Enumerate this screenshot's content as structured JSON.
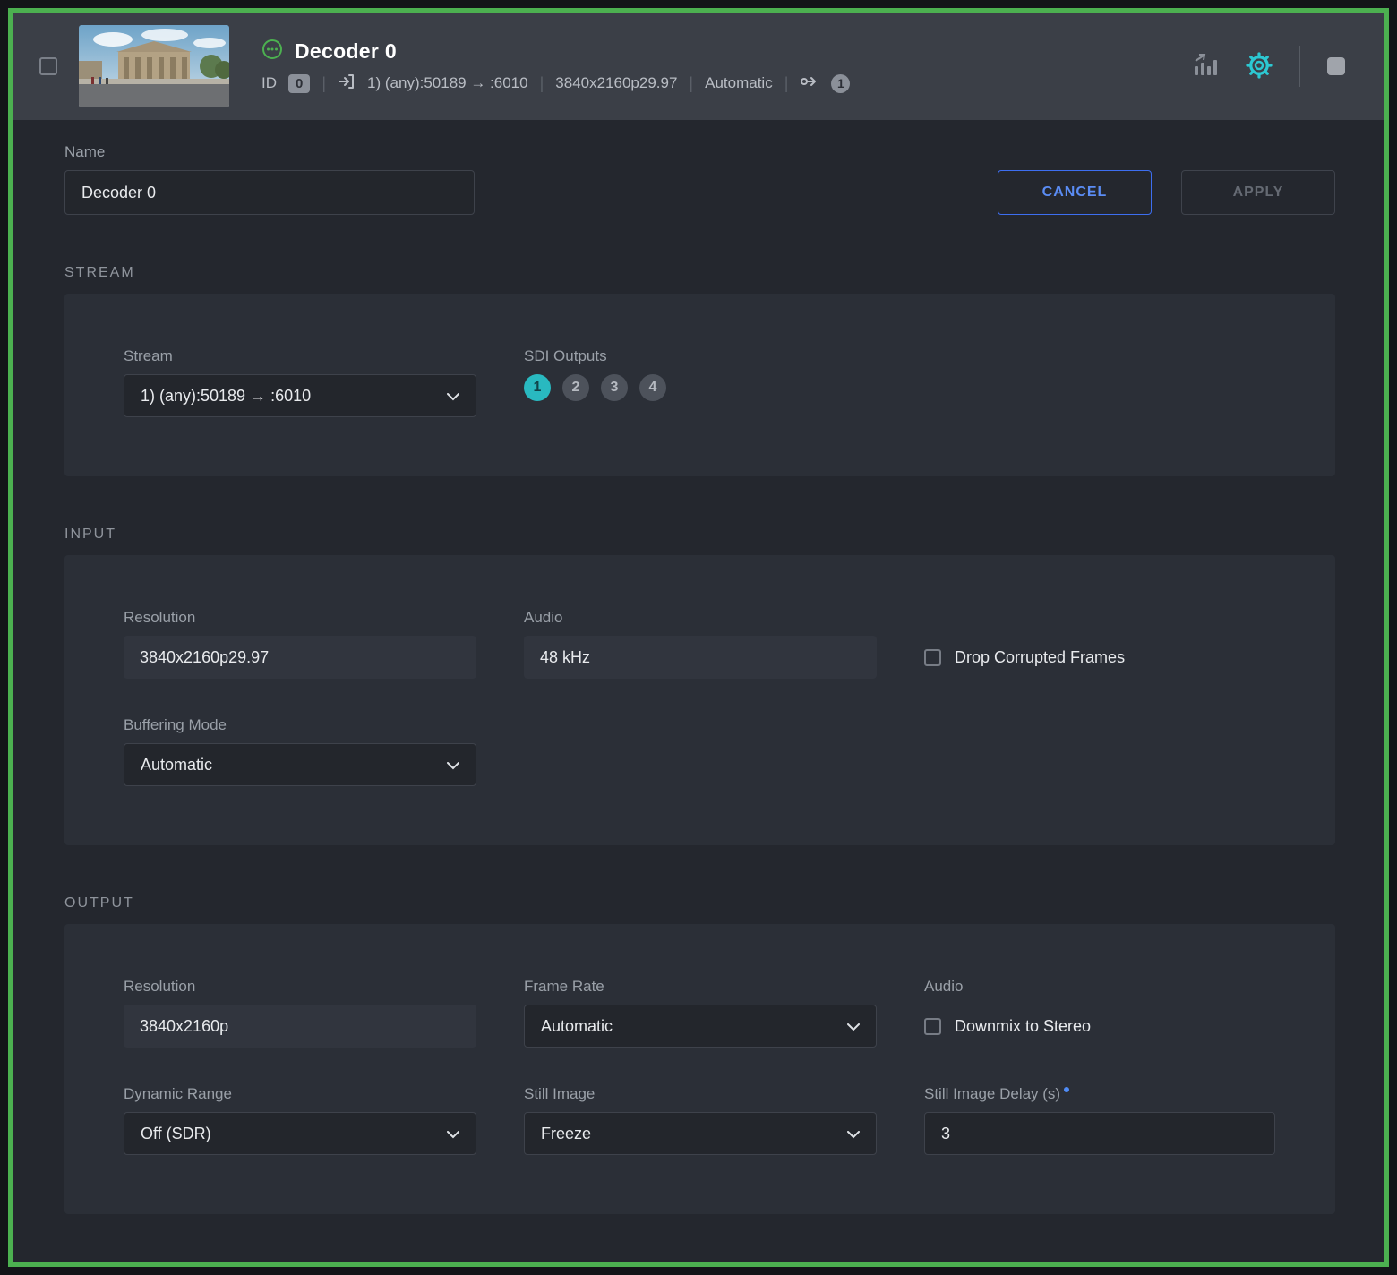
{
  "header": {
    "title": "Decoder 0",
    "id_label": "ID",
    "id_value": "0",
    "separator": "|",
    "stream_info": "1) (any):50189 → :6010",
    "resolution": "3840x2160p29.97",
    "buffering": "Automatic",
    "output_count": "1"
  },
  "name_form": {
    "label": "Name",
    "value": "Decoder 0",
    "cancel": "CANCEL",
    "apply": "APPLY"
  },
  "stream": {
    "section_title": "STREAM",
    "stream_label": "Stream",
    "stream_value": "1) (any):50189 → :6010",
    "sdi_label": "SDI Outputs",
    "sdi": [
      "1",
      "2",
      "3",
      "4"
    ]
  },
  "input": {
    "section_title": "INPUT",
    "resolution_label": "Resolution",
    "resolution": "3840x2160p29.97",
    "audio_label": "Audio",
    "audio": "48 kHz",
    "drop_corrupted": "Drop Corrupted Frames",
    "buffering_label": "Buffering Mode",
    "buffering": "Automatic"
  },
  "output": {
    "section_title": "OUTPUT",
    "resolution_label": "Resolution",
    "resolution": "3840x2160p",
    "frame_rate_label": "Frame Rate",
    "frame_rate": "Automatic",
    "audio_label": "Audio",
    "downmix": "Downmix to Stereo",
    "dynamic_range_label": "Dynamic Range",
    "dynamic_range": "Off (SDR)",
    "still_image_label": "Still Image",
    "still_image": "Freeze",
    "still_delay_label": "Still Image Delay (s)",
    "still_delay": "3"
  },
  "colors": {
    "accent_green": "#4cb050",
    "accent_teal": "#2cc8d2",
    "accent_blue": "#4f8cf7"
  }
}
